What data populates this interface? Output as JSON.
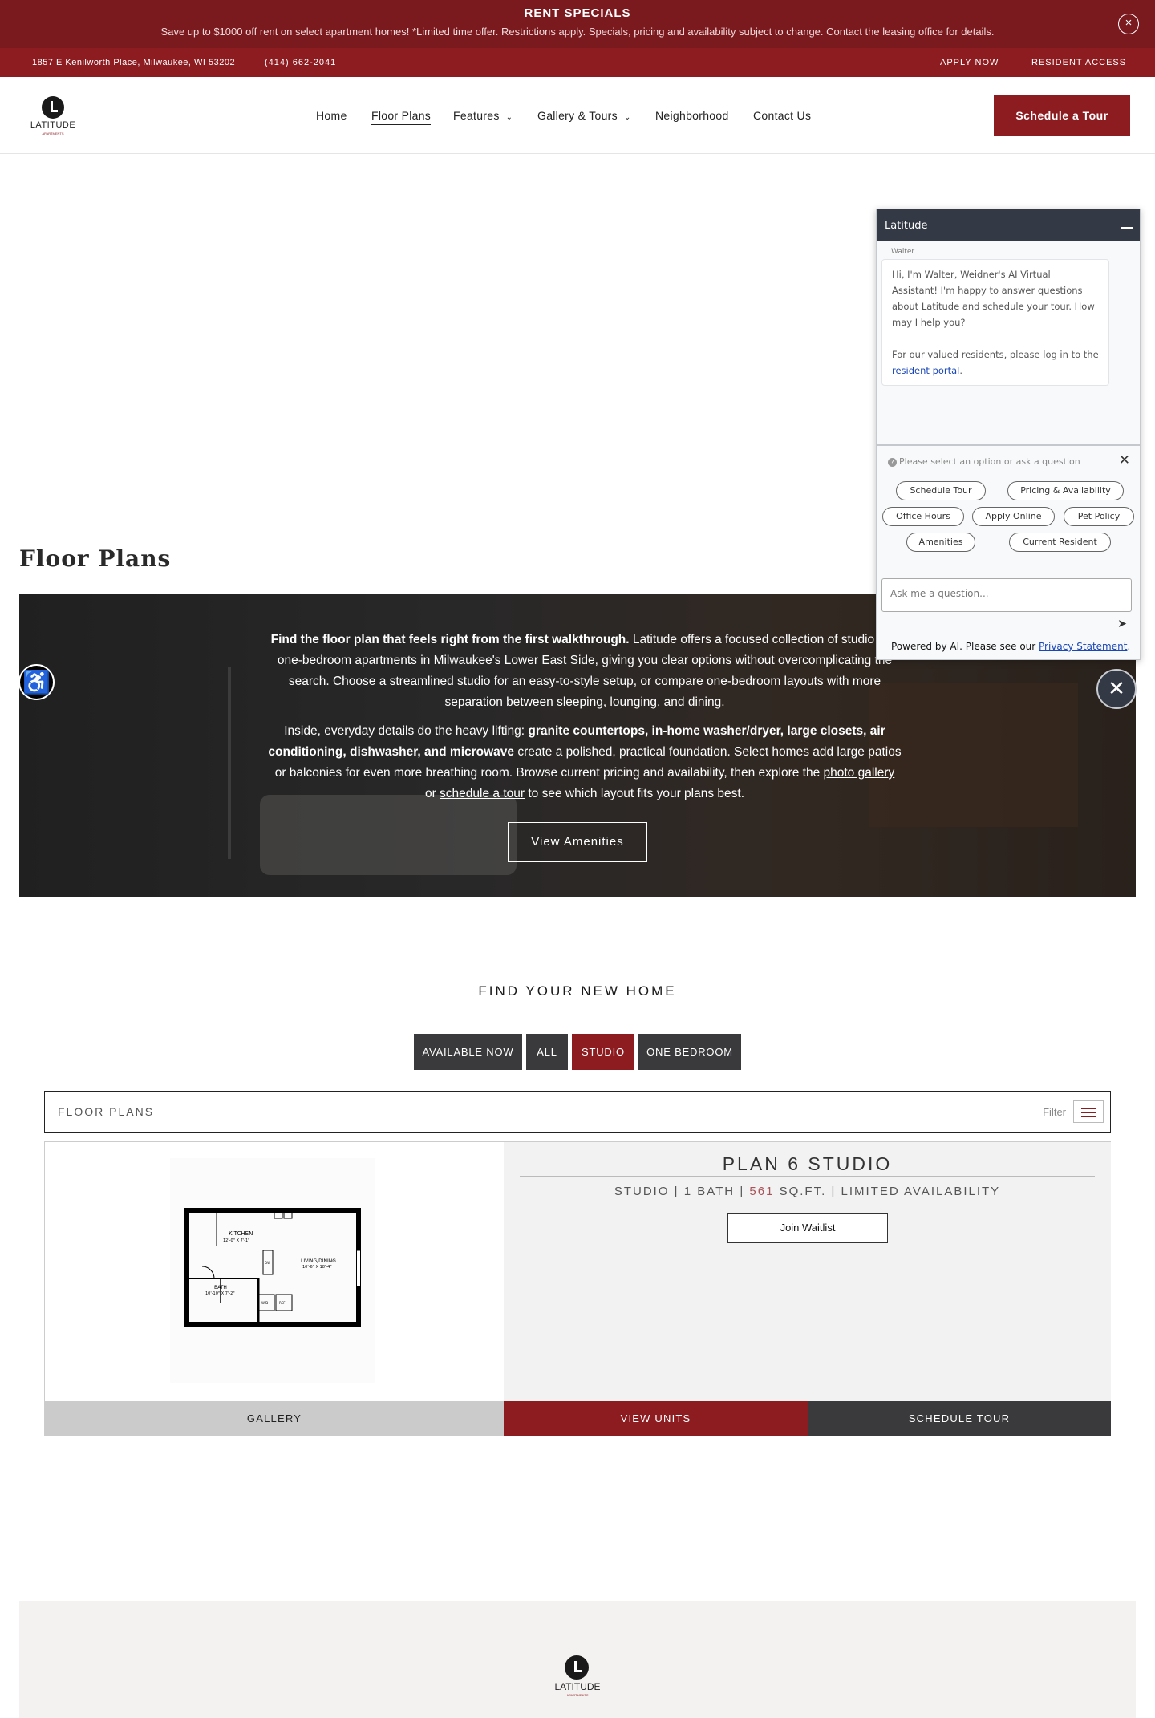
{
  "promo": {
    "title": "RENT SPECIALS",
    "text": "Save up to $1000 off rent on select apartment homes! *Limited time offer. Restrictions apply. Specials, pricing and availability subject to change. Contact the leasing office for details.",
    "close_icon": "×"
  },
  "utility": {
    "address": "1857 E Kenilworth Place, Milwaukee, WI 53202",
    "phone": "(414) 662-2041",
    "apply": "APPLY NOW",
    "resident": "RESIDENT ACCESS"
  },
  "header": {
    "logo_word": "LATITUDE",
    "logo_sub": "APARTMENTS",
    "nav": {
      "home": "Home",
      "floor_plans": "Floor Plans",
      "features": "Features",
      "gallery": "Gallery & Tours",
      "neighborhood": "Neighborhood",
      "contact": "Contact Us"
    },
    "chevron": "⌄",
    "cta": "Schedule a Tour"
  },
  "page_title": "Floor Plans",
  "hero": {
    "p1_bold": "Find the floor plan that feels right from the first walkthrough.",
    "p1_rest": " Latitude offers a focused collection of studio and one-bedroom apartments in Milwaukee's Lower East Side, giving you clear options without overcomplicating the search. Choose a streamlined studio for an easy-to-style setup, or compare one-bedroom layouts with more separation between sleeping, lounging, and dining.",
    "p2_a": "Inside, everyday details do the heavy lifting: ",
    "p2_bold": "granite countertops, in-home washer/dryer, large closets, air conditioning, dishwasher, and microwave",
    "p2_b": " create a polished, practical foundation. Select homes add large patios or balconies for even more breathing room. Browse current pricing and availability, then explore the ",
    "p2_link1": "photo gallery",
    "p2_c": " or ",
    "p2_link2": "schedule a tour",
    "p2_d": " to see which layout fits your plans best.",
    "button": "View Amenities"
  },
  "accessibility_icon": "♿",
  "find": {
    "title": "FIND YOUR NEW HOME",
    "filters": [
      "AVAILABLE NOW",
      "ALL",
      "STUDIO",
      "ONE BEDROOM"
    ],
    "active_filter": "STUDIO",
    "bar_label": "FLOOR PLANS",
    "filter_label": "Filter"
  },
  "plan": {
    "name": "PLAN 6 STUDIO",
    "type": "STUDIO",
    "bath": "1 BATH",
    "sqft": "561",
    "sqft_unit": "SQ.FT.",
    "availability": "LIMITED AVAILABILITY",
    "sep": "|",
    "waitlist": "Join Waitlist",
    "btn_gallery": "GALLERY",
    "btn_units": "VIEW UNITS",
    "btn_tour": "SCHEDULE TOUR",
    "rooms": {
      "kitchen": "KITCHEN",
      "kitchen_dim": "12'-0\" X 7'-1\"",
      "living": "LIVING/DINING",
      "living_dim": "10'-6\" X 18'-4\"",
      "bath": "BATH",
      "bath_dim": "10'-10\" X 7'-2\"",
      "dw": "DW",
      "wd": "W/D",
      "ref": "REF"
    }
  },
  "footer": {
    "logo_word": "LATITUDE",
    "logo_sub": "APARTMENTS"
  },
  "chat": {
    "title": "Latitude",
    "agent": "Walter",
    "message1": "Hi, I'm Walter, Weidner's AI Virtual Assistant! I'm happy to answer questions about Latitude and schedule your tour. How may I help you?",
    "message2": "For our valued residents, please log in to the ",
    "message2_link": "resident portal",
    "message2_end": ".",
    "prompt": "Please select an option or ask a question",
    "chips": [
      "Schedule Tour",
      "Pricing & Availability",
      "Office Hours",
      "Apply Online",
      "Pet Policy",
      "Amenities",
      "Current Resident"
    ],
    "input_placeholder": "Ask me a question...",
    "footer": "Powered by AI. Please see our ",
    "footer_link": "Privacy Statement",
    "footer_end": ".",
    "close_icon": "✕",
    "prompt_icon": "?",
    "x_icon": "✕",
    "send_icon": "➤"
  },
  "colors": {
    "brand_red": "#8d1c21",
    "promo_red": "#7a1a1f",
    "dark_button": "#3a3a3c",
    "chat_header": "#343a45"
  }
}
